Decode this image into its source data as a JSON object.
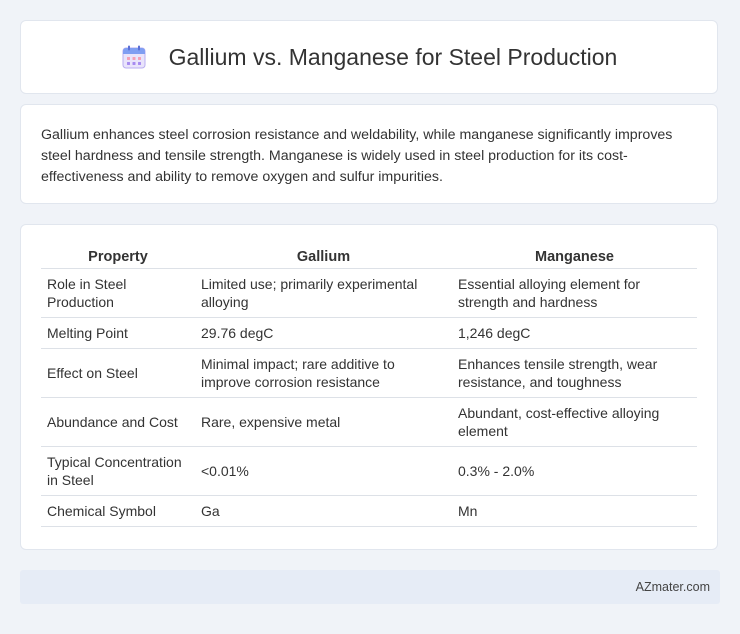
{
  "header": {
    "title": "Gallium vs. Manganese for Steel Production",
    "icon": "calendar-icon"
  },
  "summary": {
    "text": "Gallium enhances steel corrosion resistance and weldability, while manganese significantly improves steel hardness and tensile strength. Manganese is widely used in steel production for its cost-effectiveness and ability to remove oxygen and sulfur impurities."
  },
  "table": {
    "headers": [
      "Property",
      "Gallium",
      "Manganese"
    ],
    "rows": [
      [
        "Role in Steel Production",
        "Limited use; primarily experimental alloying",
        "Essential alloying element for strength and hardness"
      ],
      [
        "Melting Point",
        "29.76 degC",
        "1,246 degC"
      ],
      [
        "Effect on Steel",
        "Minimal impact; rare additive to improve corrosion resistance",
        "Enhances tensile strength, wear resistance, and toughness"
      ],
      [
        "Abundance and Cost",
        "Rare, expensive metal",
        "Abundant, cost-effective alloying element"
      ],
      [
        "Typical Concentration in Steel",
        "<0.01%",
        "0.3% - 2.0%"
      ],
      [
        "Chemical Symbol",
        "Ga",
        "Mn"
      ]
    ]
  },
  "footer": {
    "source": "AZmater.com"
  }
}
